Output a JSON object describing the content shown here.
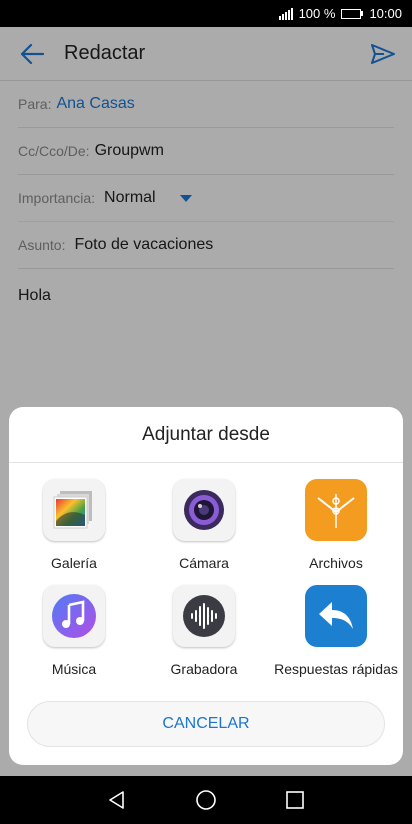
{
  "status": {
    "battery_text": "100 %",
    "time": "10:00"
  },
  "header": {
    "title": "Redactar"
  },
  "compose": {
    "to_label": "Para:",
    "to_value": "Ana Casas",
    "cc_label": "Cc/Cco/De:",
    "cc_value": "Groupwm",
    "importance_label": "Importancia:",
    "importance_value": "Normal",
    "subject_label": "Asunto:",
    "subject_value": "Foto de vacaciones",
    "body": "Hola"
  },
  "sheet": {
    "title": "Adjuntar desde",
    "items": [
      {
        "label": "Galería",
        "icon": "gallery-icon"
      },
      {
        "label": "Cámara",
        "icon": "camera-icon"
      },
      {
        "label": "Archivos",
        "icon": "files-icon"
      },
      {
        "label": "Música",
        "icon": "music-icon"
      },
      {
        "label": "Grabadora",
        "icon": "recorder-icon"
      },
      {
        "label": "Respuestas rápidas",
        "icon": "quick-replies-icon"
      }
    ],
    "cancel_label": "CANCELAR"
  },
  "colors": {
    "accent": "#1a76d2",
    "files": "#f39c1f",
    "quick_replies": "#1d7fd0",
    "music": "#7a5cf0"
  }
}
